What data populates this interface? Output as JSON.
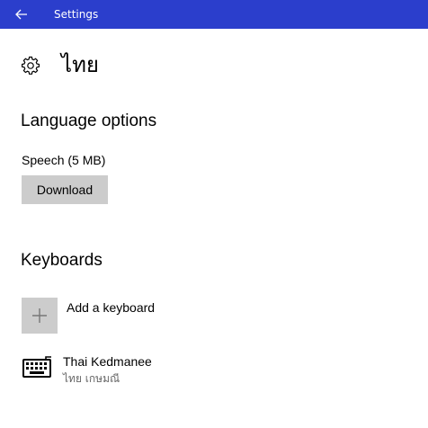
{
  "titlebar": {
    "title": "Settings",
    "back_icon": "back-arrow-icon",
    "accent": "#2b3ecc"
  },
  "header": {
    "icon": "gear-icon",
    "title": "ไทย"
  },
  "language_options": {
    "heading": "Language options",
    "speech_label": "Speech (5 MB)",
    "download_label": "Download"
  },
  "keyboards": {
    "heading": "Keyboards",
    "add_label": "Add a keyboard",
    "add_icon": "plus-icon",
    "items": [
      {
        "name": "Thai Kedmanee",
        "subtitle": "ไทย เกษมณี",
        "icon": "keyboard-icon"
      }
    ]
  }
}
